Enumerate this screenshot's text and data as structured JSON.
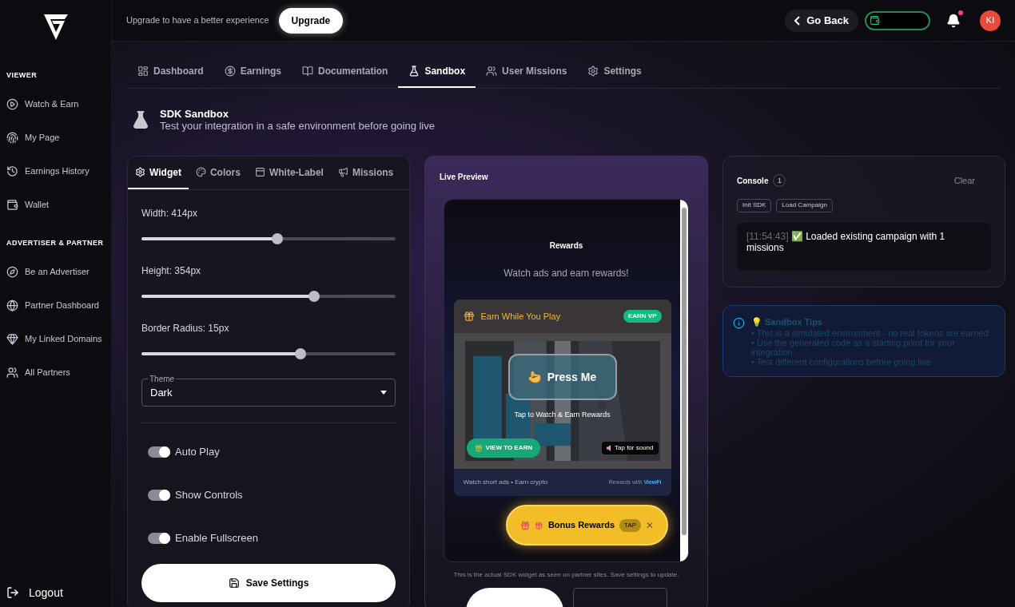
{
  "sidebar": {
    "sections": [
      {
        "title": "VIEWER",
        "items": [
          {
            "label": "Watch & Earn",
            "selected": false
          },
          {
            "label": "My Page",
            "selected": false
          },
          {
            "label": "Earnings History",
            "selected": false
          },
          {
            "label": "Wallet",
            "selected": false
          }
        ]
      },
      {
        "title": "ADVERTISER & PARTNER",
        "items": [
          {
            "label": "Be an Advertiser",
            "selected": false
          },
          {
            "label": "Partner Dashboard",
            "selected": false
          },
          {
            "label": "My Linked Domains",
            "selected": false
          },
          {
            "label": "All Partners",
            "selected": false
          }
        ]
      }
    ],
    "logout": "Logout"
  },
  "topbar": {
    "upgrade_text": "Upgrade to have a better experience",
    "upgrade_button": "Upgrade",
    "go_back": "Go Back",
    "notification_unread": true,
    "avatar": "KI"
  },
  "tabs": [
    {
      "label": "Dashboard",
      "selected": false
    },
    {
      "label": "Earnings",
      "selected": false
    },
    {
      "label": "Documentation",
      "selected": false
    },
    {
      "label": "Sandbox",
      "selected": true
    },
    {
      "label": "User Missions",
      "selected": false
    },
    {
      "label": "Settings",
      "selected": false
    }
  ],
  "header": {
    "title": "SDK Sandbox",
    "subtitle": "Test your integration in a safe environment before going live"
  },
  "settings": {
    "tabs": [
      {
        "label": "Widget",
        "selected": true
      },
      {
        "label": "Colors",
        "selected": false
      },
      {
        "label": "White-Label",
        "selected": false
      },
      {
        "label": "Missions",
        "selected": false
      }
    ],
    "sliders": [
      {
        "label": "Width: 414px",
        "level": 0.535
      },
      {
        "label": "Height: 354px",
        "level": 0.68
      },
      {
        "label": "Border Radius: 15px",
        "level": 0.626
      }
    ],
    "theme": {
      "label": "Theme",
      "value": "Dark"
    },
    "toggles": [
      {
        "label": "Auto Play",
        "on": true
      },
      {
        "label": "Show Controls",
        "on": true
      },
      {
        "label": "Enable Fullscreen",
        "on": true
      }
    ],
    "save_button": "Save Settings"
  },
  "preview": {
    "title": "Live Preview",
    "widget_title": "Rewards",
    "widget_subtitle": "Watch ads and earn rewards!",
    "card_title": "Earn While You Play",
    "card_badge": "EARN VP",
    "press_button": "Press Me",
    "tap_caption": "Tap to Watch & Earn Rewards",
    "view_button": "VIEW TO EARN",
    "sound_button": "Tap for sound",
    "footer_left": "Watch short ads • Earn crypto",
    "footer_right": "Rewards with **ViewFi**",
    "bonus": {
      "label": "Bonus Rewards",
      "badge": "TAP",
      "close": "✕"
    },
    "note": "This is the actual SDK widget as seen on partner sites. Save settings to update."
  },
  "console": {
    "title": "Console",
    "count": "1",
    "clear": "Clear",
    "actions": [
      "Init SDK",
      "Load Campaign"
    ],
    "logs": [
      {
        "time": "[11:54:43]",
        "message": "✅ Loaded existing campaign with 1 missions"
      }
    ]
  },
  "tips": {
    "title": "💡 Sandbox Tips",
    "items": [
      "• This is a simulated environment - no real tokens are earned",
      "• Use the generated code as a starting point for your integration",
      "• Test different configurations before going live"
    ]
  }
}
